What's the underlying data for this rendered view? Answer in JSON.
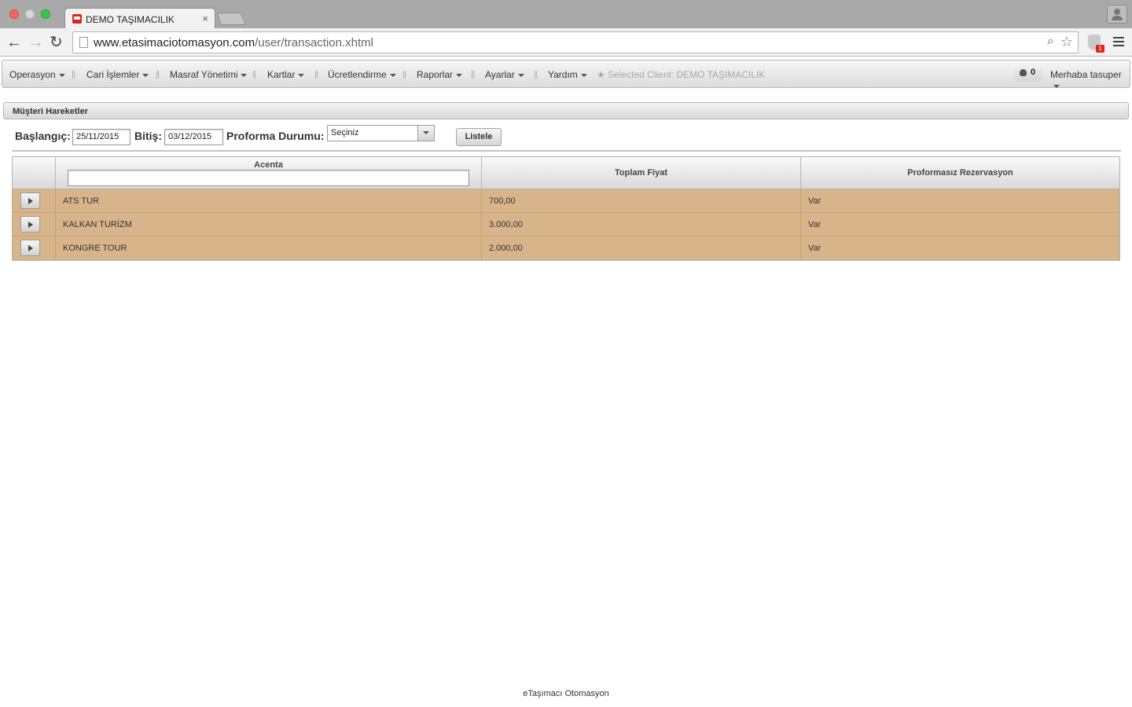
{
  "browser": {
    "tab_title": "DEMO TAŞIMACILIK",
    "tab_close": "×",
    "url_domain": "www.etasimaciotomasyon.com",
    "url_path": "/user/transaction.xhtml",
    "extension_badge": "1",
    "icons": {
      "back": "←",
      "forward": "→",
      "reload": "↻",
      "search": "⌕",
      "star": "☆"
    }
  },
  "menubar": {
    "items": [
      "Operasyon",
      "Cari İşlemler",
      "Masraf Yönetimi",
      "Kartlar",
      "Ücretlendirme",
      "Raporlar",
      "Ayarlar",
      "Yardım"
    ],
    "client_star": "★",
    "client_label": "Selected Client: DEMO TAŞIMACILIK",
    "notification_count": "0",
    "user_greeting": "Merhaba tasuper"
  },
  "panel": {
    "title": "Müşteri Hareketler"
  },
  "filters": {
    "start_label": "Başlangıç:",
    "start_value": "25/11/2015",
    "end_label": "Bitiş:",
    "end_value": "03/12/2015",
    "status_label": "Proforma Durumu:",
    "status_value": "Seçiniz",
    "list_button": "Listele"
  },
  "table": {
    "columns": [
      "Acenta",
      "Toplam Fiyat",
      "Proformasız Rezervasyon"
    ],
    "acenta_filter_value": "",
    "rows": [
      {
        "acenta": "ATS TUR",
        "toplam_fiyat": "700,00",
        "proformasiz": "Var"
      },
      {
        "acenta": "KALKAN TURİZM",
        "toplam_fiyat": "3.000,00",
        "proformasiz": "Var"
      },
      {
        "acenta": "KONGRE TOUR",
        "toplam_fiyat": "2.000,00",
        "proformasiz": "Var"
      }
    ],
    "row_color": "#d8b48b"
  },
  "footer": {
    "text": "eTaşımacı Otomasyon"
  }
}
